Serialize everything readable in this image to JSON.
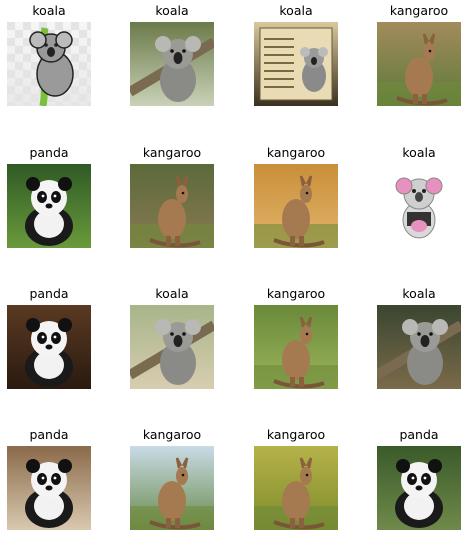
{
  "chart_data": {
    "type": "image-grid",
    "rows": 4,
    "cols": 4,
    "panels": [
      {
        "label": "koala",
        "subject": "koala",
        "style": "cartoon-clipart"
      },
      {
        "label": "koala",
        "subject": "koala",
        "style": "photo"
      },
      {
        "label": "koala",
        "subject": "koala",
        "style": "poster"
      },
      {
        "label": "kangaroo",
        "subject": "kangaroo",
        "style": "photo"
      },
      {
        "label": "panda",
        "subject": "panda",
        "style": "photo"
      },
      {
        "label": "kangaroo",
        "subject": "kangaroo",
        "style": "photo"
      },
      {
        "label": "kangaroo",
        "subject": "kangaroo",
        "style": "photo"
      },
      {
        "label": "koala",
        "subject": "koala",
        "style": "plush-toy"
      },
      {
        "label": "panda",
        "subject": "panda",
        "style": "photo"
      },
      {
        "label": "koala",
        "subject": "koala",
        "style": "photo"
      },
      {
        "label": "kangaroo",
        "subject": "kangaroo",
        "style": "photo"
      },
      {
        "label": "koala",
        "subject": "koala",
        "style": "photo"
      },
      {
        "label": "panda",
        "subject": "panda",
        "style": "photo"
      },
      {
        "label": "kangaroo",
        "subject": "kangaroo",
        "style": "photo"
      },
      {
        "label": "kangaroo",
        "subject": "kangaroo",
        "style": "photo"
      },
      {
        "label": "panda",
        "subject": "panda",
        "style": "photo"
      }
    ]
  }
}
